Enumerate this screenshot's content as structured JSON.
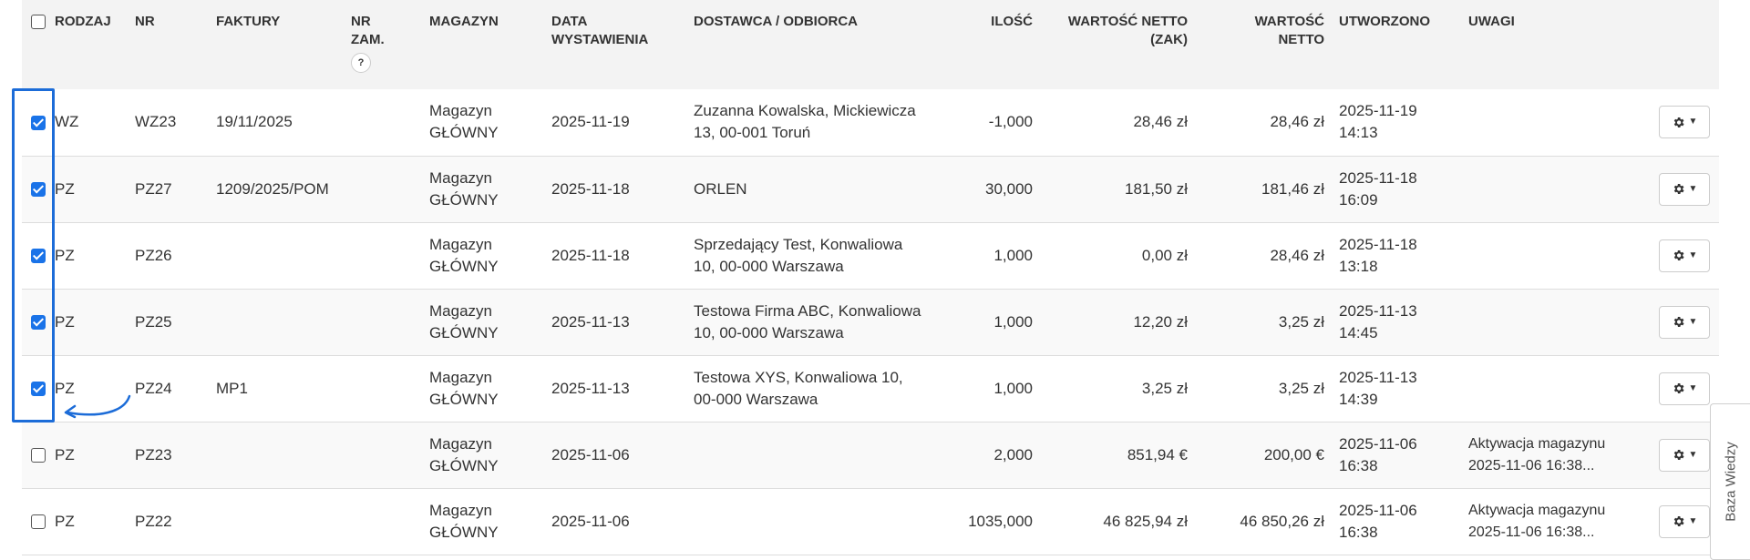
{
  "table": {
    "headers": {
      "rodzaj": "RODZAJ",
      "nr": "NR",
      "faktury": "FAKTURY",
      "nr_zam": "NR ZAM.",
      "nr_zam_help": "?",
      "magazyn": "MAGAZYN",
      "data": "DATA WYSTAWIENIA",
      "dostawca": "DOSTAWCA / ODBIORCA",
      "ilosc": "ILOŚĆ",
      "wartosc_zak": "WARTOŚĆ NETTO (ZAK)",
      "wartosc": "WARTOŚĆ NETTO",
      "utworzono": "UTWORZONO",
      "uwagi": "UWAGI"
    },
    "rows": [
      {
        "checked": true,
        "rodzaj": "WZ",
        "nr": "WZ23",
        "faktury": "19/11/2025",
        "magazyn": "Magazyn GŁÓWNY",
        "data": "2025-11-19",
        "dostawca": "Zuzanna Kowalska, Mickiewicza 13, 00-001 Toruń",
        "ilosc": "-1,000",
        "wartosc_zak": "28,46 zł",
        "wartosc": "28,46 zł",
        "utworzono": "2025-11-19 14:13",
        "uwagi": ""
      },
      {
        "checked": true,
        "rodzaj": "PZ",
        "nr": "PZ27",
        "faktury": "1209/2025/POM",
        "magazyn": "Magazyn GŁÓWNY",
        "data": "2025-11-18",
        "dostawca": "ORLEN",
        "ilosc": "30,000",
        "wartosc_zak": "181,50 zł",
        "wartosc": "181,46 zł",
        "utworzono": "2025-11-18 16:09",
        "uwagi": ""
      },
      {
        "checked": true,
        "rodzaj": "PZ",
        "nr": "PZ26",
        "faktury": "",
        "magazyn": "Magazyn GŁÓWNY",
        "data": "2025-11-18",
        "dostawca": "Sprzedający Test, Konwaliowa 10, 00-000 Warszawa",
        "ilosc": "1,000",
        "wartosc_zak": "0,00 zł",
        "wartosc": "28,46 zł",
        "utworzono": "2025-11-18 13:18",
        "uwagi": ""
      },
      {
        "checked": true,
        "rodzaj": "PZ",
        "nr": "PZ25",
        "faktury": "",
        "magazyn": "Magazyn GŁÓWNY",
        "data": "2025-11-13",
        "dostawca": "Testowa Firma ABC, Konwaliowa 10, 00-000 Warszawa",
        "ilosc": "1,000",
        "wartosc_zak": "12,20 zł",
        "wartosc": "3,25 zł",
        "utworzono": "2025-11-13 14:45",
        "uwagi": ""
      },
      {
        "checked": true,
        "rodzaj": "PZ",
        "nr": "PZ24",
        "faktury": "MP1",
        "magazyn": "Magazyn GŁÓWNY",
        "data": "2025-11-13",
        "dostawca": "Testowa XYS, Konwaliowa 10, 00-000 Warszawa",
        "ilosc": "1,000",
        "wartosc_zak": "3,25 zł",
        "wartosc": "3,25 zł",
        "utworzono": "2025-11-13 14:39",
        "uwagi": ""
      },
      {
        "checked": false,
        "rodzaj": "PZ",
        "nr": "PZ23",
        "faktury": "",
        "magazyn": "Magazyn GŁÓWNY",
        "data": "2025-11-06",
        "dostawca": "",
        "ilosc": "2,000",
        "wartosc_zak": "851,94 €",
        "wartosc": "200,00 €",
        "utworzono": "2025-11-06 16:38",
        "uwagi": "Aktywacja magazynu 2025-11-06 16:38..."
      },
      {
        "checked": false,
        "rodzaj": "PZ",
        "nr": "PZ22",
        "faktury": "",
        "magazyn": "Magazyn GŁÓWNY",
        "data": "2025-11-06",
        "dostawca": "",
        "ilosc": "1035,000",
        "wartosc_zak": "46 825,94 zł",
        "wartosc": "46 850,26 zł",
        "utworzono": "2025-11-06 16:38",
        "uwagi": "Aktywacja magazynu 2025-11-06 16:38..."
      }
    ]
  },
  "side_tab": {
    "label": "Baza Wiedzy"
  },
  "colors": {
    "highlight": "#1c6cd8",
    "checkbox": "#1a73e8",
    "header_bg": "#f3f3f3"
  },
  "icons": {
    "row_action": "gear-icon",
    "dropdown": "caret-down-icon"
  }
}
